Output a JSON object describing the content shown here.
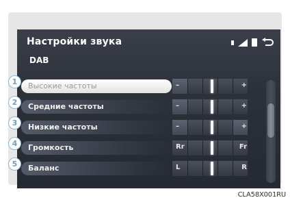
{
  "header": {
    "title": "Настройки звука",
    "subtitle": "DAB"
  },
  "icons": {
    "signal": "signal-icon",
    "battery": "battery-icon",
    "back": "back-arrow-icon"
  },
  "rows": [
    {
      "number": "1",
      "label": "Высокие частоты",
      "left": "–",
      "right": "+",
      "level": 0.5,
      "selected": true
    },
    {
      "number": "2",
      "label": "Средние частоты",
      "left": "–",
      "right": "+",
      "level": 0.5,
      "selected": false
    },
    {
      "number": "3",
      "label": "Низкие частоты",
      "left": "–",
      "right": "+",
      "level": 0.5,
      "selected": false
    },
    {
      "number": "4",
      "label": "Громкость",
      "left": "Rr",
      "right": "Fr",
      "level": 0.5,
      "selected": false
    },
    {
      "number": "5",
      "label": "Баланс",
      "left": "L",
      "right": "R",
      "level": 0.5,
      "selected": false
    }
  ],
  "watermark": "CLA58X001RU"
}
